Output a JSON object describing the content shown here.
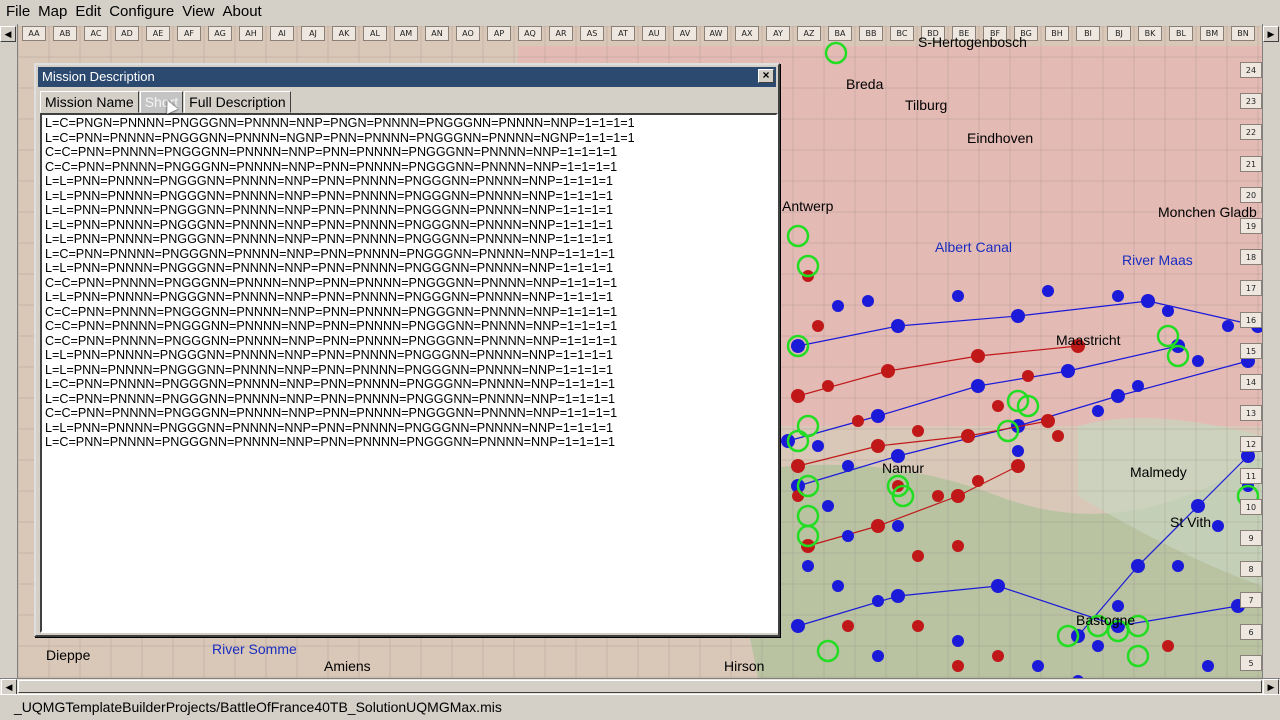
{
  "menu": [
    "File",
    "Map",
    "Edit",
    "Configure",
    "View",
    "About"
  ],
  "map": {
    "columns": [
      "AA",
      "AB",
      "AC",
      "AD",
      "AE",
      "AF",
      "AG",
      "AH",
      "AI",
      "AJ",
      "AK",
      "AL",
      "AM",
      "AN",
      "AO",
      "AP",
      "AQ",
      "AR",
      "AS",
      "AT",
      "AU",
      "AV",
      "AW",
      "AX",
      "AY",
      "AZ",
      "BA",
      "BB",
      "BC",
      "BD",
      "BE",
      "BF",
      "BG",
      "BH",
      "BI",
      "BJ",
      "BK",
      "BL",
      "BM",
      "BN"
    ],
    "rows": [
      "24",
      "23",
      "22",
      "21",
      "20",
      "19",
      "18",
      "17",
      "16",
      "15",
      "14",
      "13",
      "12",
      "11",
      "10",
      "9",
      "8",
      "7",
      "6",
      "5"
    ],
    "cities": [
      "S-Hertogenbosch",
      "Breda",
      "Tilburg",
      "Eindhoven",
      "Antwerp",
      "Monchen Gladb",
      "Maastricht",
      "Malmedy",
      "St Vith",
      "Dieppe",
      "Amiens",
      "Hirson",
      "Bastogne",
      "Namur"
    ],
    "water": [
      "Albert Canal",
      "River Maas",
      "River Somme"
    ],
    "colors": {
      "land": "#d9c8b8",
      "grid": "#9a8b84",
      "red_zone": "#e8b4b4",
      "forest": "#9fbf8f",
      "blue_unit": "#1a1ad8",
      "red_unit": "#c01818",
      "objective": "#22dd22"
    }
  },
  "dialog": {
    "title": "Mission Description",
    "close_label": "×",
    "tabs": [
      "Mission Name",
      "Short",
      "Full Description"
    ],
    "active_tab": "Short",
    "lines": [
      "L=C=PNGN=PNNNN=PNGGGNN=PNNNN=NNP=PNGN=PNNNN=PNGGGNN=PNNNN=NNP=1=1=1=1",
      "L=C=PNN=PNNNN=PNGGGNN=PNNNN=NGNP=PNN=PNNNN=PNGGGNN=PNNNN=NGNP=1=1=1=1",
      "C=C=PNN=PNNNN=PNGGGNN=PNNNN=NNP=PNN=PNNNN=PNGGGNN=PNNNN=NNP=1=1=1=1",
      "C=C=PNN=PNNNN=PNGGGNN=PNNNN=NNP=PNN=PNNNN=PNGGGNN=PNNNN=NNP=1=1=1=1",
      "L=L=PNN=PNNNN=PNGGGNN=PNNNN=NNP=PNN=PNNNN=PNGGGNN=PNNNN=NNP=1=1=1=1",
      "L=L=PNN=PNNNN=PNGGGNN=PNNNN=NNP=PNN=PNNNN=PNGGGNN=PNNNN=NNP=1=1=1=1",
      "L=L=PNN=PNNNN=PNGGGNN=PNNNN=NNP=PNN=PNNNN=PNGGGNN=PNNNN=NNP=1=1=1=1",
      "L=L=PNN=PNNNN=PNGGGNN=PNNNN=NNP=PNN=PNNNN=PNGGGNN=PNNNN=NNP=1=1=1=1",
      "L=L=PNN=PNNNN=PNGGGNN=PNNNN=NNP=PNN=PNNNN=PNGGGNN=PNNNN=NNP=1=1=1=1",
      "L=C=PNN=PNNNN=PNGGGNN=PNNNN=NNP=PNN=PNNNN=PNGGGNN=PNNNN=NNP=1=1=1=1",
      "L=L=PNN=PNNNN=PNGGGNN=PNNNN=NNP=PNN=PNNNN=PNGGGNN=PNNNN=NNP=1=1=1=1",
      "C=C=PNN=PNNNN=PNGGGNN=PNNNN=NNP=PNN=PNNNN=PNGGGNN=PNNNN=NNP=1=1=1=1",
      "L=L=PNN=PNNNN=PNGGGNN=PNNNN=NNP=PNN=PNNNN=PNGGGNN=PNNNN=NNP=1=1=1=1",
      "C=C=PNN=PNNNN=PNGGGNN=PNNNN=NNP=PNN=PNNNN=PNGGGNN=PNNNN=NNP=1=1=1=1",
      "C=C=PNN=PNNNN=PNGGGNN=PNNNN=NNP=PNN=PNNNN=PNGGGNN=PNNNN=NNP=1=1=1=1",
      "C=C=PNN=PNNNN=PNGGGNN=PNNNN=NNP=PNN=PNNNN=PNGGGNN=PNNNN=NNP=1=1=1=1",
      "L=L=PNN=PNNNN=PNGGGNN=PNNNN=NNP=PNN=PNNNN=PNGGGNN=PNNNN=NNP=1=1=1=1",
      "L=L=PNN=PNNNN=PNGGGNN=PNNNN=NNP=PNN=PNNNN=PNGGGNN=PNNNN=NNP=1=1=1=1",
      "L=C=PNN=PNNNN=PNGGGNN=PNNNN=NNP=PNN=PNNNN=PNGGGNN=PNNNN=NNP=1=1=1=1",
      "L=C=PNN=PNNNN=PNGGGNN=PNNNN=NNP=PNN=PNNNN=PNGGGNN=PNNNN=NNP=1=1=1=1",
      "C=C=PNN=PNNNN=PNGGGNN=PNNNN=NNP=PNN=PNNNN=PNGGGNN=PNNNN=NNP=1=1=1=1",
      "L=L=PNN=PNNNN=PNGGGNN=PNNNN=NNP=PNN=PNNNN=PNGGGNN=PNNNN=NNP=1=1=1=1",
      "L=C=PNN=PNNNN=PNGGGNN=PNNNN=NNP=PNN=PNNNN=PNGGGNN=PNNNN=NNP=1=1=1=1"
    ]
  },
  "statusbar": {
    "text": "_UQMGTemplateBuilderProjects/BattleOfFrance40TB_SolutionUQMGMax.mis"
  },
  "icons": [
    "scroll-left-arrow-icon",
    "scroll-right-arrow-icon",
    "mouse-cursor-icon",
    "close-icon"
  ]
}
